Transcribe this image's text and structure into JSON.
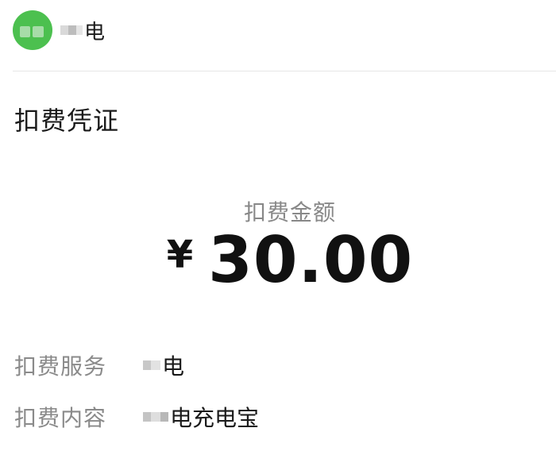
{
  "header": {
    "merchant_name": "电"
  },
  "receipt": {
    "title": "扣费凭证",
    "amount_label": "扣费金额",
    "currency": "¥",
    "amount": "30.00"
  },
  "details": [
    {
      "label": "扣费服务",
      "value": "电"
    },
    {
      "label": "扣费内容",
      "value": "电充电宝"
    }
  ],
  "colors": {
    "avatar": "#4cc04f",
    "label": "#8a8a8a",
    "text": "#1a1a1a",
    "divider": "#e6e6e6"
  }
}
